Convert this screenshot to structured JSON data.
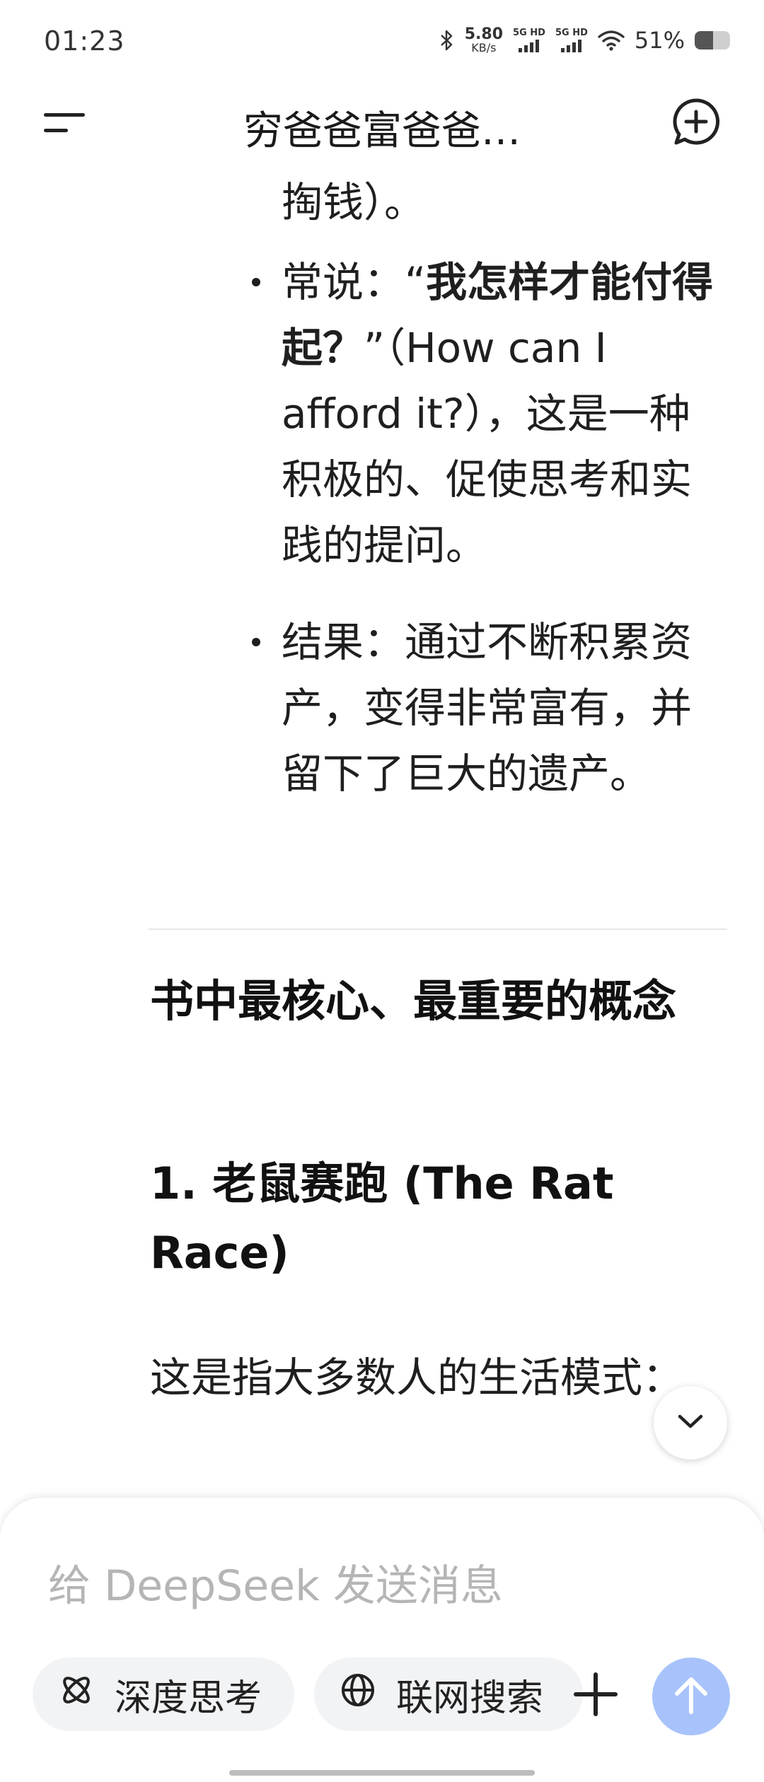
{
  "status_bar": {
    "time": "01:23",
    "net_speed": "5.80",
    "net_unit": "KB/s",
    "sim1_label": "5G HD",
    "sim2_label": "5G HD",
    "battery_percent_text": "51%",
    "battery_level": 0.51,
    "icons": [
      "bluetooth-icon",
      "signal-icon",
      "wifi-icon",
      "battery-icon"
    ]
  },
  "header": {
    "title": "穷爸爸富爸爸…",
    "menu_icon": "menu-icon",
    "new_chat_icon": "new-chat-icon"
  },
  "content": {
    "fragment": "掏钱）。",
    "bullets": [
      {
        "prefix": "常说：“",
        "bold": "我怎样才能付得起？",
        "suffix": "”（How can I afford it?），这是一种积极的、促使思考和实践的提问。"
      },
      {
        "prefix": "结果：通过不断积累资产，变得非常富有，并留下了巨大的遗产。",
        "bold": "",
        "suffix": ""
      }
    ],
    "section_title": "书中最核心、最重要的概念",
    "subsection_title": "1. 老鼠赛跑 (The Rat Race)",
    "paragraph": "这是指大多数人的生活模式："
  },
  "composer": {
    "placeholder": "给 DeepSeek 发送消息",
    "value": "",
    "deep_think_label": "深度思考",
    "web_search_label": "联网搜索"
  },
  "colors": {
    "send_button": "#a8c3fb",
    "chip_bg": "#f2f3f5",
    "placeholder": "#b5b5b5"
  }
}
